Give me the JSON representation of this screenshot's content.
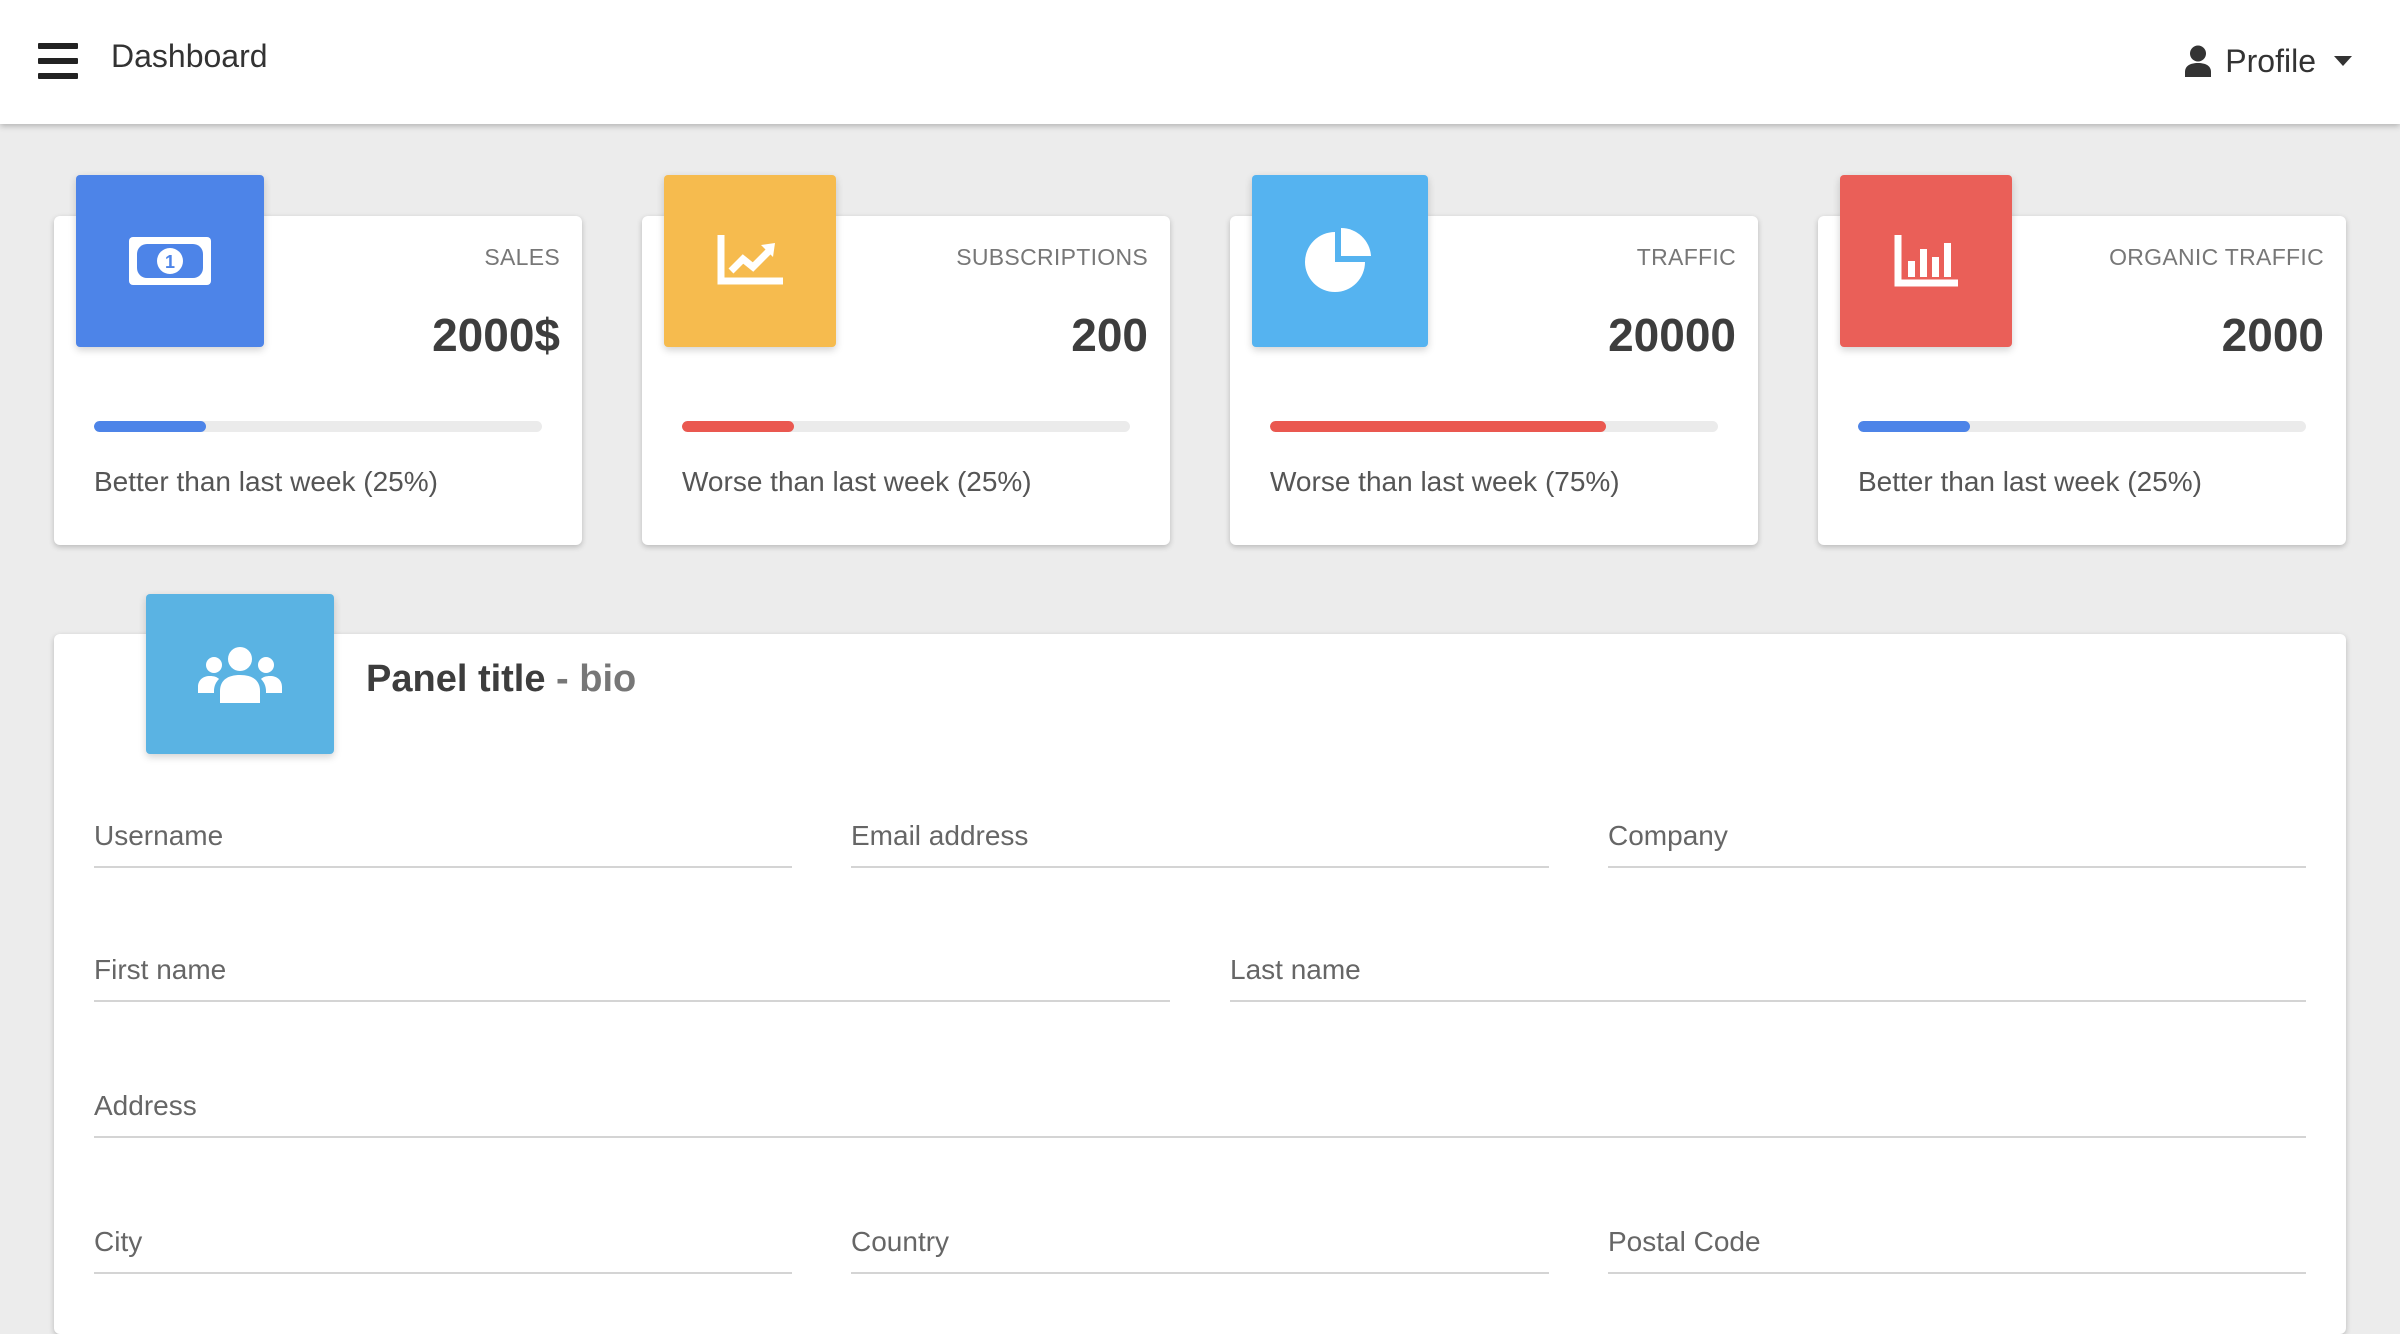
{
  "navbar": {
    "title": "Dashboard",
    "menu_icon": "hamburger-menu-icon",
    "profile_label": "Profile",
    "profile_icon": "user-icon"
  },
  "stats": [
    {
      "label": "SALES",
      "value": "2000$",
      "note": "Better than last week (25%)",
      "progress_percent": 25,
      "icon": "money-bill-icon",
      "tile_color": "#4d84e8",
      "bar_color": "#4d84e8"
    },
    {
      "label": "SUBSCRIPTIONS",
      "value": "200",
      "note": "Worse than last week (25%)",
      "progress_percent": 25,
      "icon": "chart-line-icon",
      "tile_color": "#f6bb4e",
      "bar_color": "#ea5850"
    },
    {
      "label": "TRAFFIC",
      "value": "20000",
      "note": "Worse than last week (75%)",
      "progress_percent": 75,
      "icon": "chart-pie-icon",
      "tile_color": "#55b3f0",
      "bar_color": "#ea5850"
    },
    {
      "label": "ORGANIC TRAFFIC",
      "value": "2000",
      "note": "Better than last week (25%)",
      "progress_percent": 25,
      "icon": "chart-bar-icon",
      "tile_color": "#ea5f58",
      "bar_color": "#4d84e8"
    }
  ],
  "panel": {
    "title": "Panel title",
    "separator": " - ",
    "subtitle": "bio",
    "icon": "users-icon",
    "tile_color": "#5ab3e3",
    "fields": {
      "username": "Username",
      "email": "Email address",
      "company": "Company",
      "first_name": "First name",
      "last_name": "Last name",
      "address": "Address",
      "city": "City",
      "country": "Country",
      "postal_code": "Postal Code"
    }
  }
}
